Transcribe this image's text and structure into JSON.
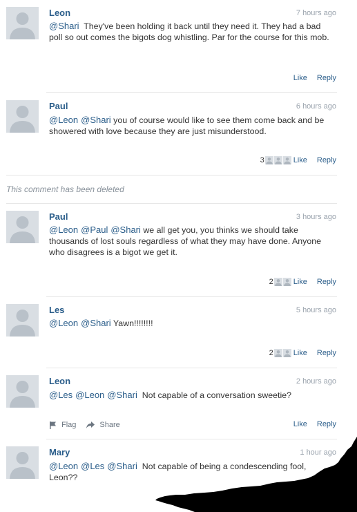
{
  "comments": [
    {
      "author": "Leon",
      "time": "7 hours ago",
      "mentions": [
        "@Shari"
      ],
      "text": "They've been holding it back until they need it. They had a bad poll so out comes the bigots dog whistling. Par for the course for this mob.",
      "likes": "",
      "like_label": "Like",
      "reply_label": "Reply"
    },
    {
      "author": "Paul",
      "time": "6 hours ago",
      "mentions": [
        "@Leon",
        "@Shari"
      ],
      "text": "you of course would like to see them come back and be showered with love because they are just misunderstood.",
      "likes": "3",
      "like_label": "Like",
      "reply_label": "Reply"
    },
    {
      "author": "Paul",
      "time": "3 hours ago",
      "mentions": [
        "@Leon",
        "@Paul",
        "@Shari"
      ],
      "text": "we all get you, you thinks we should take thousands of lost souls regardless of what they may have done. Anyone who disagrees is a bigot we get it.",
      "likes": "2",
      "like_label": "Like",
      "reply_label": "Reply"
    },
    {
      "author": "Les",
      "time": "5 hours ago",
      "mentions": [
        "@Leon",
        "@Shari"
      ],
      "text": "Yawn!!!!!!!!",
      "likes": "2",
      "like_label": "Like",
      "reply_label": "Reply"
    },
    {
      "author": "Leon",
      "time": "2 hours ago",
      "mentions": [
        "@Les",
        "@Leon",
        "@Shari"
      ],
      "text": "Not capable of a conversation sweetie?",
      "likes": "",
      "like_label": "Like",
      "reply_label": "Reply",
      "flag_label": "Flag",
      "share_label": "Share"
    },
    {
      "author": "Mary",
      "time": "1 hour ago",
      "mentions": [
        "@Leon",
        "@Les",
        "@Shari"
      ],
      "text": "Not capable of being a condescending fool, Leon??"
    }
  ],
  "deleted_notice": "This comment has been deleted",
  "icons": {
    "avatar": "default-user-avatar",
    "flag": "flag-icon",
    "share": "share-icon"
  },
  "colors": {
    "link": "#2a5d8a",
    "timestamp": "#9aa3ad",
    "avatar_bg": "#d9dee3"
  }
}
